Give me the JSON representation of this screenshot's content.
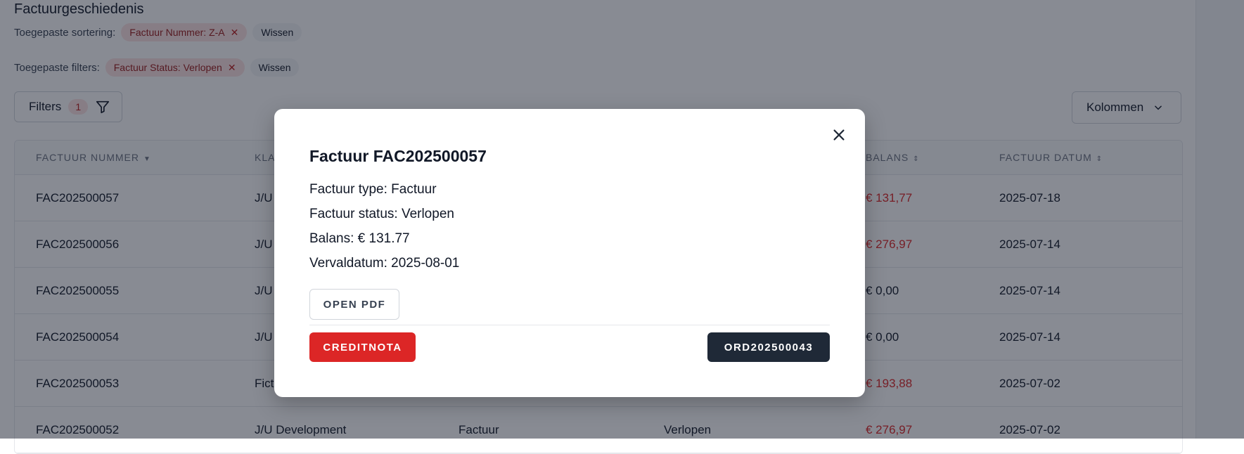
{
  "page": {
    "title": "Factuurgeschiedenis",
    "sorting": {
      "label": "Toegepaste sortering:",
      "chip": "Factuur Nummer: Z-A",
      "clear": "Wissen"
    },
    "filters_applied": {
      "label": "Toegepaste filters:",
      "chip": "Factuur Status: Verlopen",
      "clear": "Wissen"
    },
    "filters_button": {
      "label": "Filters",
      "count": "1"
    },
    "columns_button": {
      "label": "Kolommen"
    }
  },
  "table": {
    "headers": [
      "Factuur Nummer",
      "Kla",
      "",
      "",
      "Balans",
      "Factuur Datum"
    ],
    "rows": [
      {
        "number": "FAC202500057",
        "client": "J/U",
        "type": "",
        "status": "",
        "balance": "€ 131,77",
        "date": "2025-07-18",
        "balance_red": true
      },
      {
        "number": "FAC202500056",
        "client": "J/U",
        "type": "",
        "status": "",
        "balance": "€ 276,97",
        "date": "2025-07-14",
        "balance_red": true
      },
      {
        "number": "FAC202500055",
        "client": "J/U",
        "type": "",
        "status": "",
        "balance": "€ 0,00",
        "date": "2025-07-14",
        "balance_red": false
      },
      {
        "number": "FAC202500054",
        "client": "J/U",
        "type": "",
        "status": "",
        "balance": "€ 0,00",
        "date": "2025-07-14",
        "balance_red": false
      },
      {
        "number": "FAC202500053",
        "client": "Fict",
        "type": "",
        "status": "",
        "balance": "€ 193,88",
        "date": "2025-07-02",
        "balance_red": true
      },
      {
        "number": "FAC202500052",
        "client": "J/U Development",
        "type": "Factuur",
        "status": "Verlopen",
        "balance": "€ 276,97",
        "date": "2025-07-02",
        "balance_red": true
      }
    ]
  },
  "modal": {
    "title": "Factuur FAC202500057",
    "details": [
      "Factuur type: Factuur",
      "Factuur status: Verlopen",
      "Balans: € 131.77",
      "Vervaldatum: 2025-08-01"
    ],
    "open_pdf": "OPEN PDF",
    "creditnota": "CREDITNOTA",
    "order": "ORD202500043"
  },
  "colors": {
    "accent_red": "#dc2626",
    "dark": "#1f2937"
  }
}
